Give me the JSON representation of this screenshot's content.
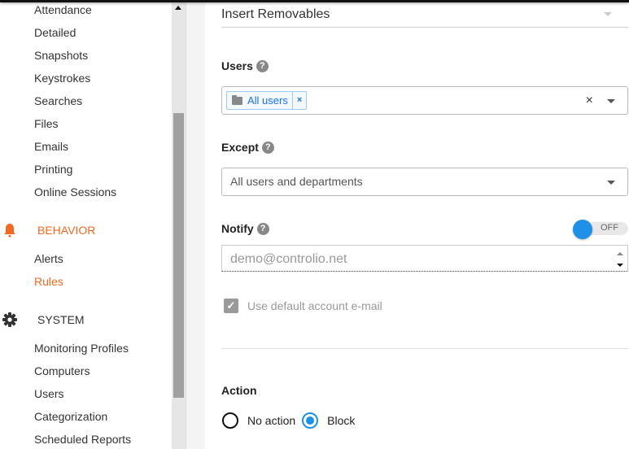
{
  "sidebar": {
    "reports_items": [
      {
        "label": "Attendance"
      },
      {
        "label": "Detailed"
      },
      {
        "label": "Snapshots"
      },
      {
        "label": "Keystrokes"
      },
      {
        "label": "Searches"
      },
      {
        "label": "Files"
      },
      {
        "label": "Emails"
      },
      {
        "label": "Printing"
      },
      {
        "label": "Online Sessions"
      }
    ],
    "behavior": {
      "label": "BEHAVIOR",
      "icon": "bell-icon",
      "items": [
        {
          "label": "Alerts",
          "active": false
        },
        {
          "label": "Rules",
          "active": true
        }
      ]
    },
    "system": {
      "label": "SYSTEM",
      "icon": "gear-icon",
      "items": [
        {
          "label": "Monitoring Profiles"
        },
        {
          "label": "Computers"
        },
        {
          "label": "Users"
        },
        {
          "label": "Categorization"
        },
        {
          "label": "Scheduled Reports"
        }
      ]
    }
  },
  "form": {
    "rule_type": {
      "value": "Insert Removables"
    },
    "users": {
      "label": "Users",
      "help": "?",
      "tags": [
        {
          "label": "All users",
          "remove": "×"
        }
      ],
      "clear": "×"
    },
    "except": {
      "label": "Except",
      "help": "?",
      "placeholder": "All users and departments"
    },
    "notify": {
      "label": "Notify",
      "help": "?",
      "toggle_state": "OFF",
      "email_value": "demo@controlio.net",
      "use_default_label": "Use default account e-mail",
      "use_default_checked": true
    },
    "action": {
      "label": "Action",
      "options": [
        {
          "label": "No action",
          "selected": false
        },
        {
          "label": "Block",
          "selected": true
        }
      ]
    }
  },
  "colors": {
    "accent_orange": "#f26a21",
    "accent_blue": "#1e90e6"
  }
}
